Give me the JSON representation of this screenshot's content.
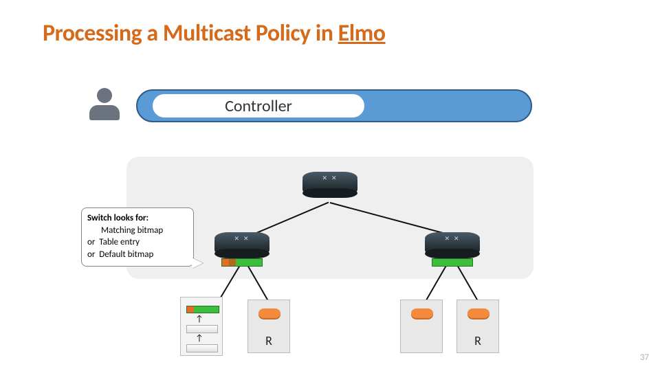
{
  "title_a": "Processing a Multicast Policy in ",
  "title_b": "Elmo",
  "controller_label": "Controller",
  "callout": {
    "heading": "Switch looks for:",
    "line1": "Matching bitmap",
    "or1": "or",
    "line2": "Table entry",
    "or2": "or",
    "line3": "Default bitmap"
  },
  "icons": {
    "user": "user-icon",
    "switch": "network-switch-icon",
    "disk": "disk-icon"
  },
  "hosts": {
    "r_label": "R"
  },
  "pagenum": "37"
}
